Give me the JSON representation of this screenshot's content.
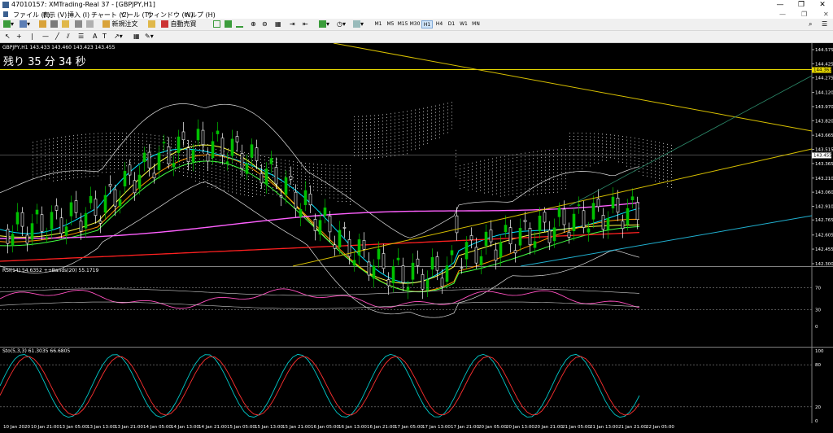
{
  "window": {
    "title": "47010157: XMTrading-Real 37 - [GBPJPY,H1]",
    "controls": [
      "—",
      "❐",
      "✕"
    ]
  },
  "menu": [
    "ファイル (F)",
    "表示 (V)",
    "挿入 (I)",
    "チャート (C)",
    "ツール (T)",
    "ウィンドウ (W)",
    "ヘルプ (H)"
  ],
  "toolbar": {
    "new_order": "新規注文",
    "auto_trade": "自動売買"
  },
  "timeframes": [
    "M1",
    "M5",
    "M15",
    "M30",
    "H1",
    "H4",
    "D1",
    "W1",
    "MN"
  ],
  "active_timeframe": "H1",
  "chart": {
    "header": "GBPJPY,H1  143.433 143.460 143.423 143.455",
    "countdown": "残り 35 分 34 秒",
    "price_labels": [
      "144.575",
      "144.425",
      "144.275",
      "144.120",
      "143.970",
      "143.820",
      "143.665",
      "143.515",
      "143.365",
      "143.210",
      "143.060",
      "142.910",
      "142.765",
      "142.605",
      "142.455",
      "142.300"
    ],
    "current_price": "143.455",
    "hline_price": "144.363",
    "rsi_header": "RSI(14) 54.6352   ++Bands(20) 55.1719",
    "rsi_levels": [
      "70",
      "30",
      "0"
    ],
    "stoch_header": "Sto(5,3,3) 61.3035 66.6805",
    "stoch_levels": [
      "100",
      "80",
      "20",
      "0"
    ],
    "time_labels": [
      "10 Jan 2020",
      "10 Jan 21:00",
      "13 Jan 05:00",
      "13 Jan 13:00",
      "13 Jan 21:00",
      "14 Jan 05:00",
      "14 Jan 13:00",
      "14 Jan 21:00",
      "15 Jan 05:00",
      "15 Jan 13:00",
      "15 Jan 21:00",
      "16 Jan 05:00",
      "16 Jan 13:00",
      "16 Jan 21:00",
      "17 Jan 05:00",
      "17 Jan 13:00",
      "17 Jan 21:00",
      "20 Jan 05:00",
      "20 Jan 13:00",
      "20 Jan 21:00",
      "21 Jan 05:00",
      "21 Jan 13:00",
      "21 Jan 21:00",
      "22 Jan 05:00"
    ]
  },
  "colors": {
    "background": "#000000",
    "bull": "#00c000",
    "bear": "#ffffff",
    "grid": "#303030",
    "text": "#ffffff"
  }
}
